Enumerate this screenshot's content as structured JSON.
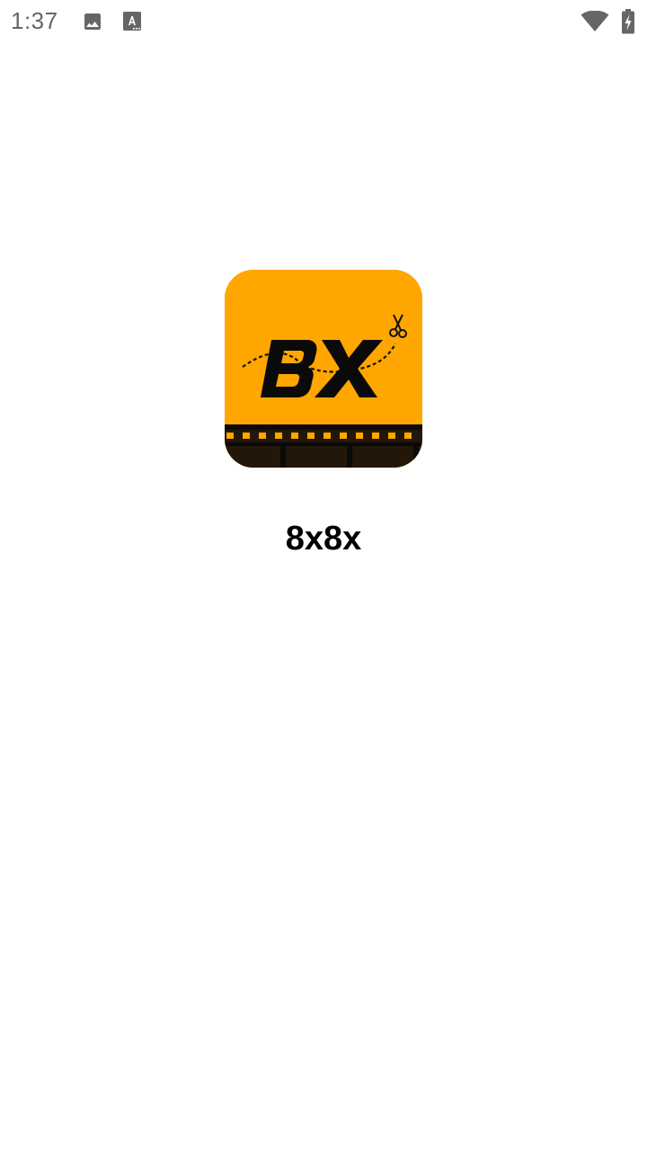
{
  "status_bar": {
    "time": "1:37",
    "icons": [
      "image-icon",
      "font-download-icon",
      "wifi-icon",
      "battery-charging-icon"
    ],
    "icon_color": "#666666"
  },
  "splash": {
    "app_name": "8x8x",
    "logo": {
      "text": "8X",
      "background_color": "#ffa600",
      "film_strip_color": "#231709",
      "icons": [
        "scissors-icon",
        "film-strip-icon"
      ]
    }
  },
  "colors": {
    "background": "#ffffff",
    "brand": "#ffa600",
    "text": "#000000"
  }
}
